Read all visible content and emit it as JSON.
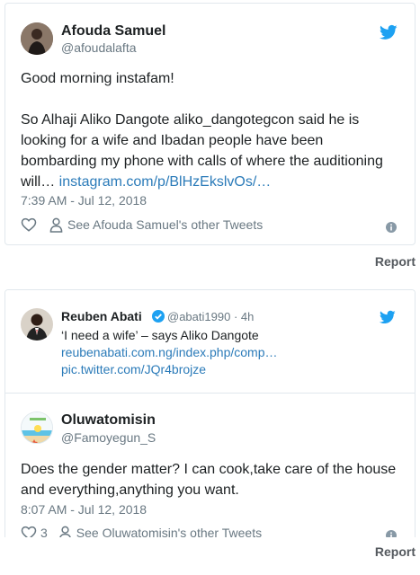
{
  "tweet1": {
    "author_name": "Afouda Samuel",
    "author_handle": "@afoudalafta",
    "line1": "Good morning instafam!",
    "para2_line1": "So Alhaji Aliko Dangote aliko_dangotegcon said he is",
    "para2_line2": "looking for a wife and Ibadan people have been",
    "para2_line3": "bombarding my phone with calls of where the auditioning",
    "para2_line4_text": "will… ",
    "para2_line4_link": "instagram.com/p/BlHzEkslvOs/…",
    "timestamp": "7:39 AM - Jul 12, 2018",
    "like_icon": "heart-icon",
    "other_tweets_label": "See Afouda Samuel's other Tweets",
    "report_label": "Report"
  },
  "tweet2": {
    "quoted": {
      "author_name": "Reuben Abati",
      "author_handle": "@abati1990",
      "age": "· 4h",
      "text": "‘I need a wife’ – says Aliko Dangote",
      "link1": "reubenabati.com.ng/index.php/comp…",
      "link2": "pic.twitter.com/JQr4brojze"
    },
    "author_name": "Oluwatomisin",
    "author_handle": "@Famoyegun_S",
    "line1": "Does the gender matter? I can cook,take care of the house",
    "line2": "and everything,anything you want.",
    "timestamp": "8:07 AM - Jul 12, 2018",
    "like_count": "3",
    "other_tweets_label": "See Oluwatomisin's other Tweets",
    "report_label": "Report"
  },
  "colors": {
    "brand_blue": "#1da1f2",
    "link_blue": "#2b7bb9",
    "muted_gray": "#697882",
    "border": "#e1e8ed"
  }
}
